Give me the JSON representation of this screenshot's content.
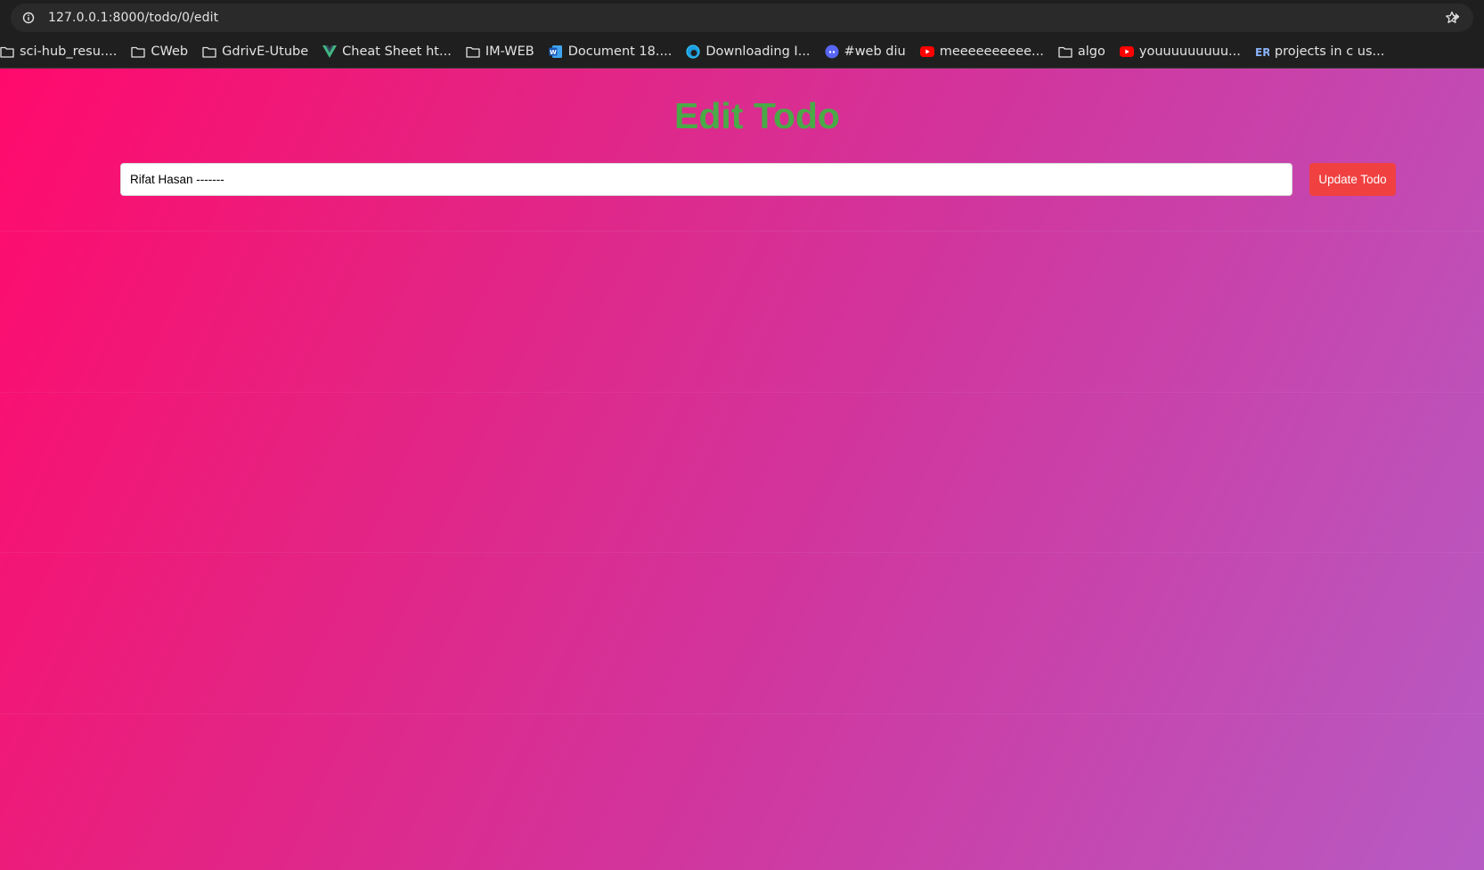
{
  "browser": {
    "url": "127.0.0.1:8000/todo/0/edit",
    "bookmarks": [
      {
        "label": "sci-hub_resu....",
        "icon": "folder-icon"
      },
      {
        "label": "CWeb",
        "icon": "folder-icon"
      },
      {
        "label": "GdrivE-Utube",
        "icon": "folder-icon"
      },
      {
        "label": "Cheat Sheet ht...",
        "icon": "vue-logo-icon"
      },
      {
        "label": "IM-WEB",
        "icon": "folder-icon"
      },
      {
        "label": "Document 18....",
        "icon": "word-icon"
      },
      {
        "label": "Downloading I...",
        "icon": "edge-icon"
      },
      {
        "label": "#web diu",
        "icon": "discord-icon"
      },
      {
        "label": "meeeeeeeeee...",
        "icon": "youtube-icon"
      },
      {
        "label": "algo",
        "icon": "folder-icon"
      },
      {
        "label": "youuuuuuuuu...",
        "icon": "youtube-icon"
      },
      {
        "label": "projects in c us...",
        "icon": "er-icon"
      }
    ]
  },
  "page": {
    "title": "Edit Todo",
    "todo_value": "Rifat Hasan -------",
    "update_label": "Update Todo"
  },
  "colors": {
    "title": "#4aaa47",
    "button": "#f04040",
    "gradient_start": "#ff0a6c",
    "gradient_end": "#b75bc4"
  }
}
